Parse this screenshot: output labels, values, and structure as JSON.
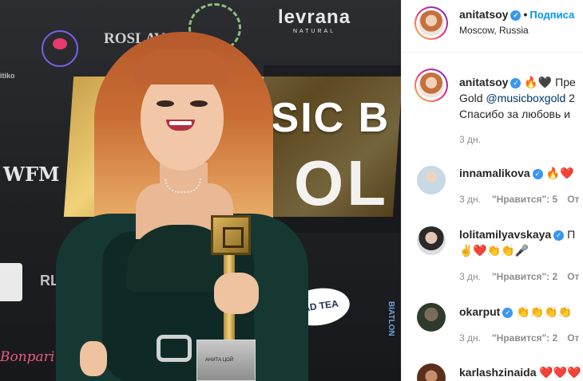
{
  "post": {
    "author": "anitatsoy",
    "location": "Moscow, Russia",
    "follow_label": "Подписа",
    "separator": "•",
    "caption_emojis": "🔥🖤",
    "caption_line1_rest": "Пре",
    "caption_line2_a": "Gold ",
    "caption_line2_link": "@musicboxgold",
    "caption_line2_b": " 2",
    "caption_line3": "Спасибо за любовь и",
    "caption_time": "3 дн."
  },
  "photo": {
    "wall_logos": {
      "levrana": "levrana",
      "levrana_sub": "NATURAL",
      "roslav": "ROSLAV",
      "wfm": "WFM",
      "itiko": "itiko",
      "rl": "RL",
      "bonpari": "Bonpari",
      "tea": "IMAD TEA",
      "vertical": "BIATLON"
    },
    "banner_line1": "USIC B",
    "banner_line2": "OL",
    "trophy_plate": "АНИТА ЦОЙ"
  },
  "comments": [
    {
      "user": "innamalikova",
      "text": "🔥❤️",
      "time": "3 дн.",
      "likes": "\"Нравится\": 5",
      "reply": "От"
    },
    {
      "user": "lolitamilyavskaya",
      "text": "П",
      "text2": "✌️❤️👏👏🎤",
      "time": "3 дн.",
      "likes": "\"Нравится\": 2",
      "reply": "От"
    },
    {
      "user": "okarput",
      "text": "👏👏👏👏",
      "time": "3 дн.",
      "likes": "\"Нравится\": 2",
      "reply": "От"
    },
    {
      "user": "karlashzinaida",
      "text": "❤️❤️❤️",
      "time": "",
      "likes": "",
      "reply": ""
    }
  ],
  "icons": {
    "verified": "✓",
    "like": "♡"
  },
  "colors": {
    "accent": "#0095f6",
    "link": "#00376b",
    "muted": "#8e8e8e",
    "verified": "#3897f0"
  }
}
